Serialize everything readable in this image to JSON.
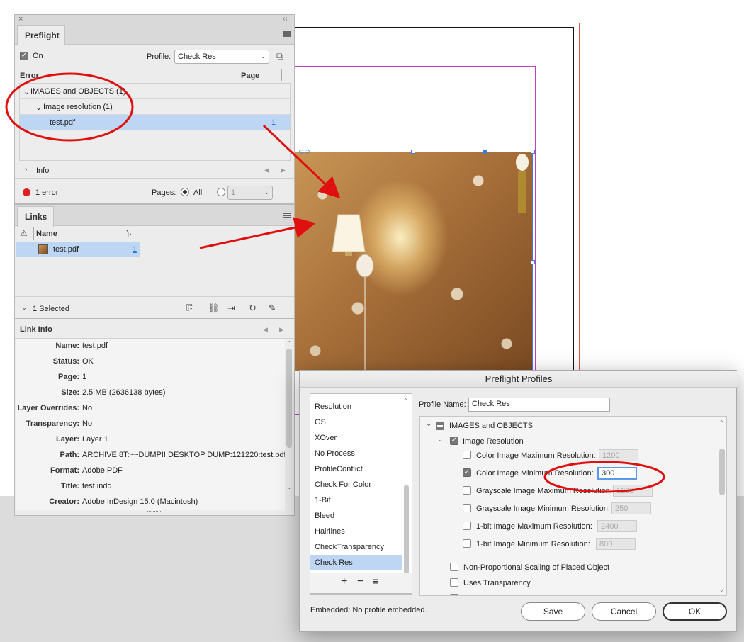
{
  "preflight": {
    "close": "×",
    "collapse": "‹‹",
    "tab": "Preflight",
    "on_label": "On",
    "profile_label": "Profile:",
    "profile_value": "Check Res",
    "col_error": "Error",
    "col_page": "Page",
    "tree": [
      {
        "label": "IMAGES and OBJECTS (1)",
        "expander": "⌄"
      },
      {
        "label": "Image resolution (1)",
        "expander": "⌄"
      },
      {
        "label": "test.pdf",
        "page": "1"
      }
    ],
    "info_label": "Info",
    "error_count": "1 error",
    "pages_label": "Pages:",
    "pages_all": "All",
    "pages_range": "1"
  },
  "links": {
    "tab": "Links",
    "col_name": "Name",
    "rows": [
      {
        "name": "test.pdf",
        "page": "1"
      }
    ],
    "selected": "1 Selected"
  },
  "link_info": {
    "title": "Link Info",
    "fields": [
      {
        "label": "Name:",
        "value": "test.pdf"
      },
      {
        "label": "Status:",
        "value": "OK"
      },
      {
        "label": "Page:",
        "value": "1"
      },
      {
        "label": "Size:",
        "value": "2.5 MB (2636138 bytes)"
      },
      {
        "label": "Layer Overrides:",
        "value": "No"
      },
      {
        "label": "Transparency:",
        "value": "No"
      },
      {
        "label": "Layer:",
        "value": "Layer 1"
      },
      {
        "label": "Path:",
        "value": "ARCHIVE 8T:~~DUMP!!:DESKTOP DUMP:121220:test.pdf"
      },
      {
        "label": "Format:",
        "value": "Adobe PDF"
      },
      {
        "label": "Title:",
        "value": "test.indd"
      },
      {
        "label": "Creator:",
        "value": "Adobe InDesign 15.0 (Macintosh)"
      }
    ]
  },
  "dialog": {
    "title": "Preflight Profiles",
    "profiles": [
      "Resolution",
      "GS",
      "XOver",
      "No Process",
      "ProfileConflict",
      "Check For Color",
      "1-Bit",
      "Bleed",
      "Hairlines",
      "CheckTransparency",
      "Check Res"
    ],
    "list_add": "+",
    "list_remove": "−",
    "list_menu": "≡",
    "profile_name_label": "Profile Name:",
    "profile_name_value": "Check Res",
    "section": "IMAGES and OBJECTS",
    "subsection": "Image Resolution",
    "settings": [
      {
        "label": "Color Image Maximum Resolution:",
        "value": "1200",
        "checked": false
      },
      {
        "label": "Color Image Minimum Resolution:",
        "value": "300",
        "checked": true
      },
      {
        "label": "Grayscale Image Maximum Resolution:",
        "value": "1200",
        "checked": false
      },
      {
        "label": "Grayscale Image Minimum Resolution:",
        "value": "250",
        "checked": false
      },
      {
        "label": "1-bit Image Maximum Resolution:",
        "value": "2400",
        "checked": false
      },
      {
        "label": "1-bit Image Minimum Resolution:",
        "value": "800",
        "checked": false
      }
    ],
    "extra": [
      "Non-Proportional Scaling of Placed Object",
      "Uses Transparency"
    ],
    "embedded": "Embedded: No profile embedded.",
    "save": "Save",
    "cancel": "Cancel",
    "ok": "OK"
  },
  "colors": {
    "annotation": "#e01010",
    "selection": "#bdd6f3",
    "frame": "#3a7be0"
  }
}
